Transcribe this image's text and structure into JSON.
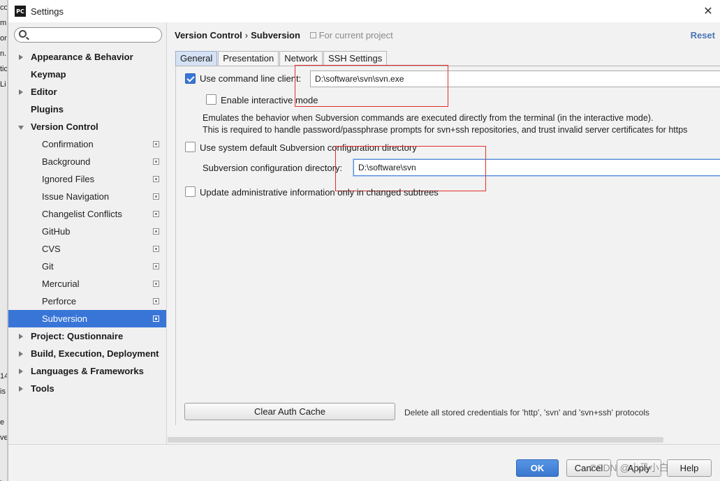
{
  "window": {
    "title": "Settings",
    "app_icon": "PC"
  },
  "edge_fragments": [
    "co",
    "m",
    "or",
    "n.",
    "tic",
    "Li",
    "",
    "",
    "",
    "",
    "",
    "",
    "",
    "",
    "",
    "",
    "",
    "",
    "",
    "",
    "",
    "",
    "",
    "",
    "14",
    "is",
    "",
    "e",
    "ve",
    "",
    "",
    "le"
  ],
  "sidebar": {
    "search_placeholder": "",
    "items": [
      {
        "label": "Appearance & Behavior",
        "level": "top",
        "arrow": "right"
      },
      {
        "label": "Keymap",
        "level": "top",
        "arrow": "none"
      },
      {
        "label": "Editor",
        "level": "top",
        "arrow": "right"
      },
      {
        "label": "Plugins",
        "level": "top",
        "arrow": "none"
      },
      {
        "label": "Version Control",
        "level": "top",
        "arrow": "down"
      },
      {
        "label": "Confirmation",
        "level": "child"
      },
      {
        "label": "Background",
        "level": "child"
      },
      {
        "label": "Ignored Files",
        "level": "child"
      },
      {
        "label": "Issue Navigation",
        "level": "child"
      },
      {
        "label": "Changelist Conflicts",
        "level": "child"
      },
      {
        "label": "GitHub",
        "level": "child"
      },
      {
        "label": "CVS",
        "level": "child"
      },
      {
        "label": "Git",
        "level": "child"
      },
      {
        "label": "Mercurial",
        "level": "child"
      },
      {
        "label": "Perforce",
        "level": "child"
      },
      {
        "label": "Subversion",
        "level": "child",
        "selected": true
      },
      {
        "label": "Project: Qustionnaire",
        "level": "top",
        "arrow": "right"
      },
      {
        "label": "Build, Execution, Deployment",
        "level": "top",
        "arrow": "right"
      },
      {
        "label": "Languages & Frameworks",
        "level": "top",
        "arrow": "right"
      },
      {
        "label": "Tools",
        "level": "top",
        "arrow": "right"
      }
    ]
  },
  "header": {
    "crumb1": "Version Control",
    "separator": "›",
    "crumb2": "Subversion",
    "scope": "For current project",
    "reset": "Reset"
  },
  "tabs": [
    {
      "label": "General",
      "active": true
    },
    {
      "label": "Presentation",
      "active": false
    },
    {
      "label": "Network",
      "active": false
    },
    {
      "label": "SSH Settings",
      "active": false
    }
  ],
  "general": {
    "use_cmd_label": "Use command line client:",
    "use_cmd_checked": true,
    "cmd_path": "D:\\software\\svn\\svn.exe",
    "interactive_label": "Enable interactive mode",
    "interactive_checked": false,
    "desc_line1": "Emulates the behavior when Subversion commands are executed directly from the terminal (in the interactive mode).",
    "desc_line2": "This is required to handle password/passphrase prompts for svn+ssh repositories, and trust invalid server certificates for https",
    "use_default_dir_label": "Use system default Subversion configuration directory",
    "use_default_dir_checked": false,
    "config_dir_label": "Subversion configuration directory:",
    "config_dir_value": "D:\\software\\svn",
    "update_admin_label": "Update administrative information only in changed subtrees",
    "update_admin_checked": false,
    "clear_cache": "Clear Auth Cache",
    "clear_cache_note": "Delete all stored credentials for 'http', 'svn' and 'svn+ssh' protocols"
  },
  "footer": {
    "ok": "OK",
    "cancel": "Cancel",
    "apply": "Apply",
    "help": "Help",
    "watermark": "CSDN @小马小白"
  },
  "colors": {
    "accent": "#3875d7",
    "link": "#4a74b5",
    "highlight_box": "#e03030"
  }
}
